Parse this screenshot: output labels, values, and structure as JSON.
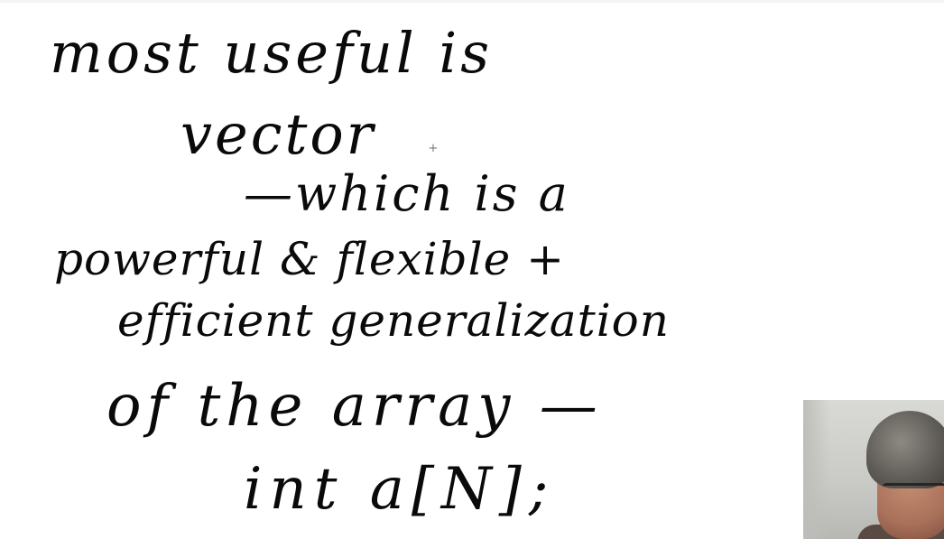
{
  "board": {
    "lines": [
      "most useful is",
      "vector",
      "—which is a",
      "powerful & flexible +",
      "efficient generalization",
      "of the array —",
      "int a[N];"
    ]
  },
  "colors": {
    "ink": "#0a0a0a",
    "background": "#ffffff"
  },
  "webcam": {
    "description_icon": "presenter-webcam-icon"
  },
  "cursor": {
    "glyph": "+"
  }
}
